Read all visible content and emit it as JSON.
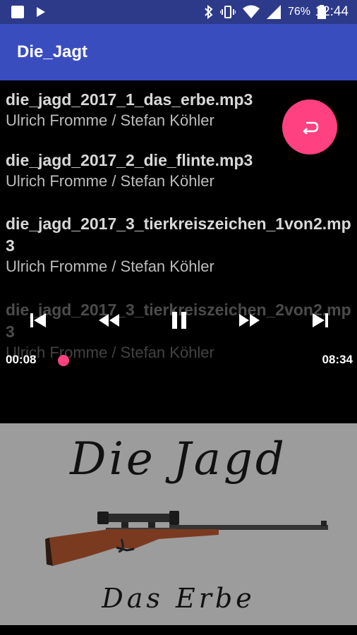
{
  "status_bar": {
    "battery": "76%",
    "time": "12:44",
    "icons": [
      "square-icon",
      "play-icon",
      "bluetooth-icon",
      "vibrate-icon",
      "wifi-icon",
      "signal-icon",
      "battery-icon"
    ]
  },
  "app_bar": {
    "title": "Die_Jagt"
  },
  "tracks": [
    {
      "title": "die_jagd_2017_1_das_erbe.mp3",
      "artist": "Ulrich Fromme / Stefan Köhler"
    },
    {
      "title": "die_jagd_2017_2_die_flinte.mp3",
      "artist": "Ulrich Fromme / Stefan Köhler"
    },
    {
      "title": "die_jagd_2017_3_tierkreiszeichen_1von2.mp3",
      "artist": "Ulrich Fromme / Stefan Köhler"
    },
    {
      "title": "die_jagd_2017_3_tierkreiszeichen_2von2.mp3",
      "artist": "Ulrich Fromme / Stefan Köhler"
    }
  ],
  "player": {
    "elapsed": "00:08",
    "duration": "08:34",
    "progress_fraction": 0.016,
    "accent": "#ff4081"
  },
  "cover": {
    "title": "Die Jagd",
    "subtitle": "Das Erbe"
  }
}
